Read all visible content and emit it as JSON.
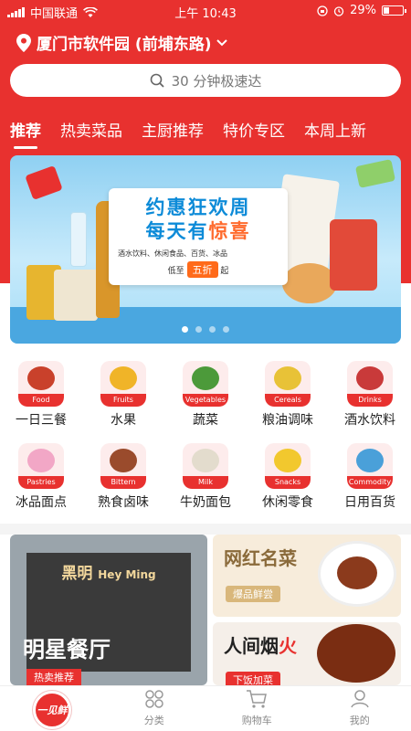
{
  "status_bar": {
    "carrier": "中国联通",
    "time": "上午 10:43",
    "battery": "29%",
    "battery_level": 0.29
  },
  "location": {
    "text": "厦门市软件园 (前埔东路)"
  },
  "search": {
    "placeholder": "30 分钟极速达"
  },
  "tabs": [
    {
      "label": "推荐",
      "active": true
    },
    {
      "label": "热卖菜品"
    },
    {
      "label": "主厨推荐"
    },
    {
      "label": "特价专区"
    },
    {
      "label": "本周上新"
    }
  ],
  "banner": {
    "title_line1": "约惠狂欢周",
    "title_line2_a": "每天有",
    "title_line2_b": "惊喜",
    "subtitle": "酒水饮料、休闲食品、百货、冰品",
    "discount_prefix": "低至",
    "discount": "五折",
    "discount_suffix": "起",
    "page_count": 4,
    "current_page": 1
  },
  "categories": [
    {
      "label": "一日三餐",
      "tag": "Food",
      "color": "#c9412b"
    },
    {
      "label": "水果",
      "tag": "Fruits",
      "color": "#f0b428"
    },
    {
      "label": "蔬菜",
      "tag": "Vegetables",
      "color": "#4c9a3a"
    },
    {
      "label": "粮油调味",
      "tag": "Cereals",
      "color": "#e8c237"
    },
    {
      "label": "酒水饮料",
      "tag": "Drinks",
      "color": "#c93a3a"
    },
    {
      "label": "冰品面点",
      "tag": "Pastries",
      "color": "#f2a7c6"
    },
    {
      "label": "熟食卤味",
      "tag": "Bittern",
      "color": "#9a4b2c"
    },
    {
      "label": "牛奶面包",
      "tag": "Milk",
      "color": "#e3dccd"
    },
    {
      "label": "休闲零食",
      "tag": "Snacks",
      "color": "#f2c82e"
    },
    {
      "label": "日用百货",
      "tag": "Commodity",
      "color": "#4aa0d9"
    }
  ],
  "promos": {
    "restaurant": {
      "sign_cn": "黑明",
      "sign_en": "Hey Ming",
      "title": "明星餐厅",
      "footer": "热卖推荐"
    },
    "dish": {
      "title": "网红名菜",
      "chip": "爆品鲜尝"
    },
    "home": {
      "title_a": "人间烟",
      "title_b": "火",
      "chip": "下饭加菜"
    }
  },
  "tabbar": [
    {
      "label": "",
      "name": "home"
    },
    {
      "label": "分类",
      "name": "category"
    },
    {
      "label": "购物车",
      "name": "cart"
    },
    {
      "label": "我的",
      "name": "profile"
    }
  ],
  "brand": {
    "logo_text": "一见鲜"
  },
  "colors": {
    "accent": "#e8312f",
    "banner_blue": "#0d8bd8"
  }
}
